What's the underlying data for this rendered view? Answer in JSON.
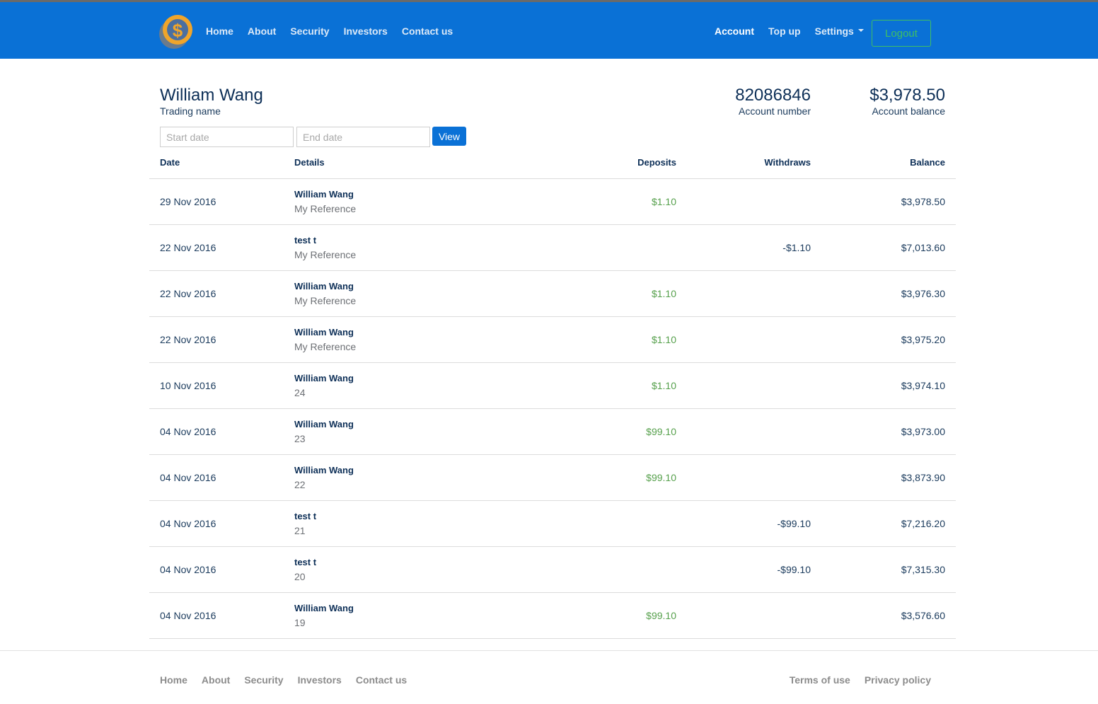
{
  "nav": {
    "left": [
      "Home",
      "About",
      "Security",
      "Investors",
      "Contact us"
    ],
    "account": "Account",
    "topup": "Top up",
    "settings": "Settings",
    "logout": "Logout"
  },
  "profile": {
    "name": "William Wang",
    "name_label": "Trading name",
    "account_number": "82086846",
    "account_number_label": "Account number",
    "balance": "$3,978.50",
    "balance_label": "Account balance"
  },
  "filter": {
    "start_placeholder": "Start date",
    "end_placeholder": "End date",
    "view_label": "View"
  },
  "table": {
    "headers": {
      "date": "Date",
      "details": "Details",
      "deposits": "Deposits",
      "withdraws": "Withdraws",
      "balance": "Balance"
    },
    "rows": [
      {
        "date": "29 Nov 2016",
        "name": "William Wang",
        "ref": "My Reference",
        "deposit": "$1.10",
        "withdraw": "",
        "balance": "$3,978.50"
      },
      {
        "date": "22 Nov 2016",
        "name": "test t",
        "ref": "My Reference",
        "deposit": "",
        "withdraw": "-$1.10",
        "balance": "$7,013.60"
      },
      {
        "date": "22 Nov 2016",
        "name": "William Wang",
        "ref": "My Reference",
        "deposit": "$1.10",
        "withdraw": "",
        "balance": "$3,976.30"
      },
      {
        "date": "22 Nov 2016",
        "name": "William Wang",
        "ref": "My Reference",
        "deposit": "$1.10",
        "withdraw": "",
        "balance": "$3,975.20"
      },
      {
        "date": "10 Nov 2016",
        "name": "William Wang",
        "ref": "24",
        "deposit": "$1.10",
        "withdraw": "",
        "balance": "$3,974.10"
      },
      {
        "date": "04 Nov 2016",
        "name": "William Wang",
        "ref": "23",
        "deposit": "$99.10",
        "withdraw": "",
        "balance": "$3,973.00"
      },
      {
        "date": "04 Nov 2016",
        "name": "William Wang",
        "ref": "22",
        "deposit": "$99.10",
        "withdraw": "",
        "balance": "$3,873.90"
      },
      {
        "date": "04 Nov 2016",
        "name": "test t",
        "ref": "21",
        "deposit": "",
        "withdraw": "-$99.10",
        "balance": "$7,216.20"
      },
      {
        "date": "04 Nov 2016",
        "name": "test t",
        "ref": "20",
        "deposit": "",
        "withdraw": "-$99.10",
        "balance": "$7,315.30"
      },
      {
        "date": "04 Nov 2016",
        "name": "William Wang",
        "ref": "19",
        "deposit": "$99.10",
        "withdraw": "",
        "balance": "$3,576.60"
      }
    ]
  },
  "footer": {
    "left": [
      "Home",
      "About",
      "Security",
      "Investors",
      "Contact us"
    ],
    "right": [
      "Terms of use",
      "Privacy policy"
    ]
  },
  "colors": {
    "brand": "#0a71d6",
    "deposit": "#56a04c",
    "logout": "#3fbf63"
  },
  "icons": {
    "logo": "dollar-coin-logo-icon",
    "settings_caret": "caret-down-icon"
  }
}
